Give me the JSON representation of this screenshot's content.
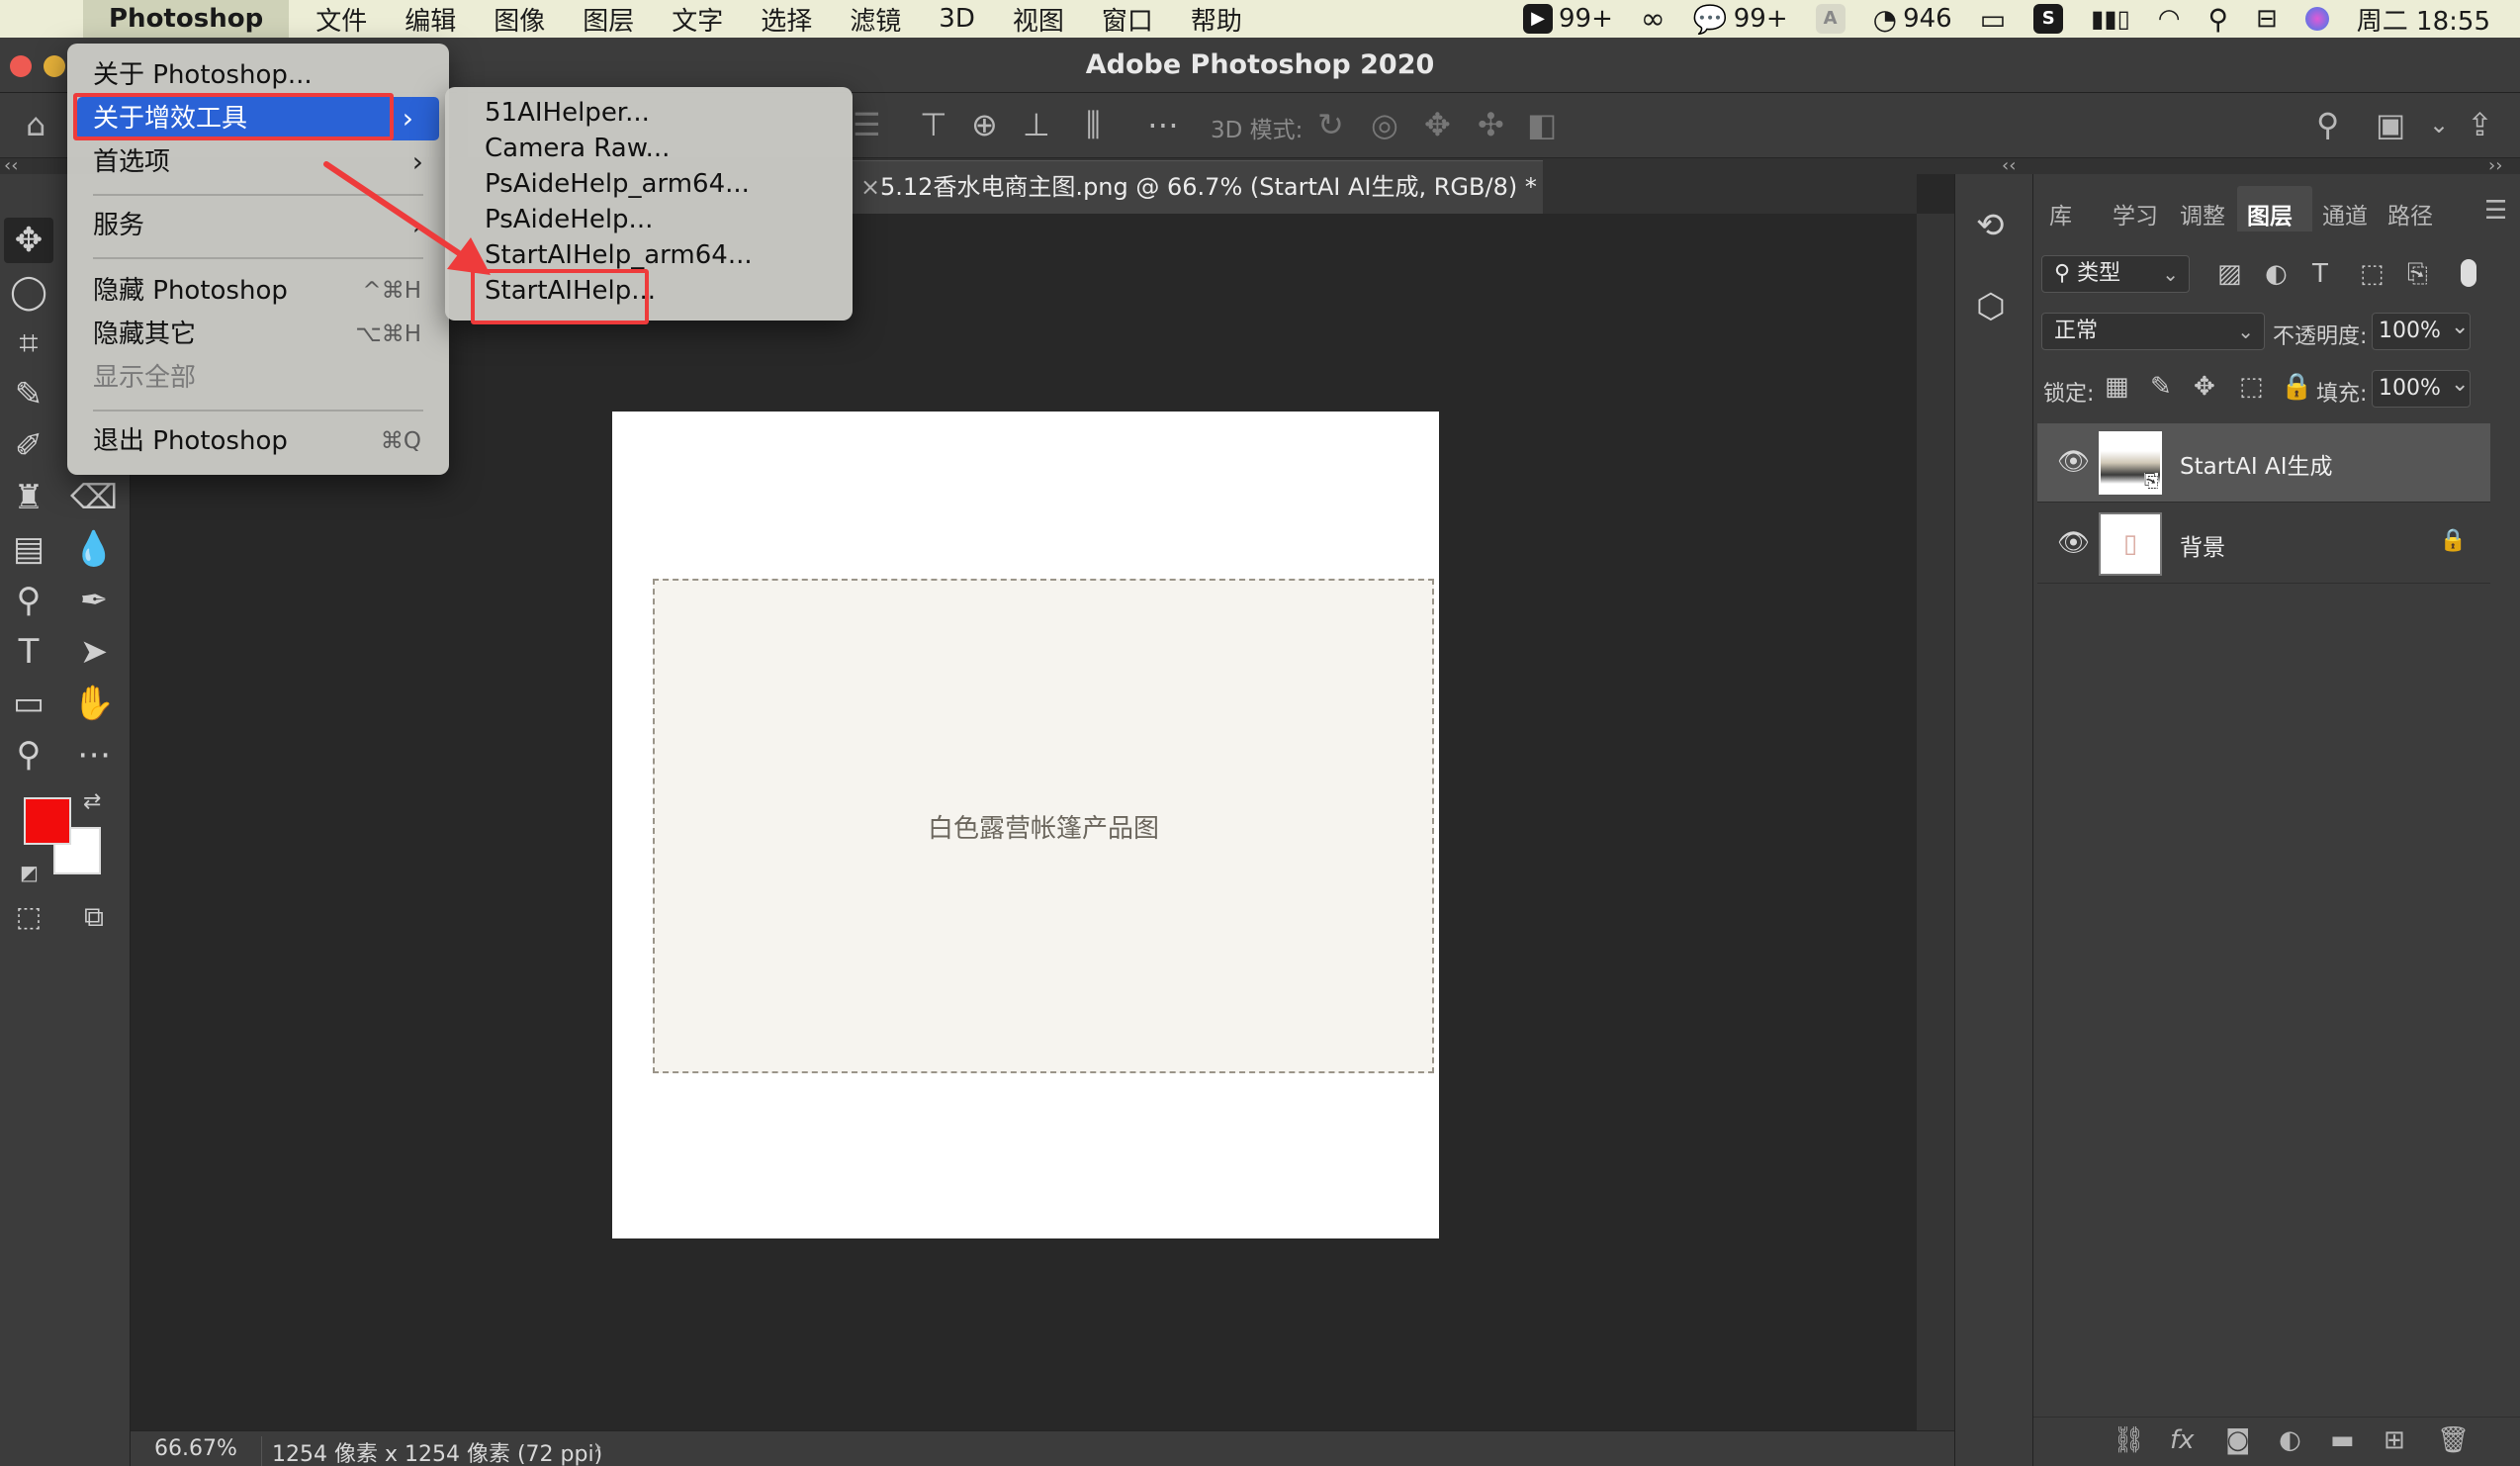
{
  "menubar": {
    "app_name": "Photoshop",
    "items": [
      "文件",
      "编辑",
      "图像",
      "图层",
      "文字",
      "选择",
      "滤镜",
      "3D",
      "视图",
      "窗口",
      "帮助"
    ],
    "status": {
      "feishu_count": "99+",
      "wechat_count": "99+",
      "qq_count": "946",
      "clock": "周二 18:55"
    }
  },
  "window": {
    "title": "Adobe Photoshop 2020"
  },
  "options_bar": {
    "mode_3d_label": "3D 模式:"
  },
  "document": {
    "tab_title": "5.12香水电商主图.png @ 66.7% (StartAI AI生成, RGB/8) *",
    "image_description": "白色露营帐篷产品图"
  },
  "status_bar": {
    "zoom": "66.67%",
    "doc_size": "1254 像素 x 1254 像素 (72 ppi)"
  },
  "app_menu": {
    "items": [
      {
        "label": "关于 Photoshop..."
      },
      {
        "label": "关于增效工具"
      },
      {
        "label": "首选项"
      },
      {
        "label": "服务"
      },
      {
        "label": "隐藏 Photoshop",
        "shortcut": "^⌘H"
      },
      {
        "label": "隐藏其它",
        "shortcut": "⌥⌘H"
      },
      {
        "label": "显示全部"
      },
      {
        "label": "退出 Photoshop",
        "shortcut": "⌘Q"
      }
    ]
  },
  "plugins_submenu": {
    "items": [
      "51AIHelper...",
      "Camera Raw...",
      "PsAideHelp_arm64...",
      "PsAideHelp...",
      "StartAIHelp_arm64...",
      "StartAIHelp..."
    ]
  },
  "layers_panel": {
    "tabs": [
      "库",
      "学习",
      "调整",
      "图层",
      "通道",
      "路径"
    ],
    "active_tab": "图层",
    "filter_kind": "类型",
    "blend_mode": "正常",
    "opacity_label": "不透明度:",
    "opacity_value": "100%",
    "lock_label": "锁定:",
    "fill_label": "填充:",
    "fill_value": "100%",
    "layers": [
      {
        "name": "StartAI AI生成",
        "selected": true
      },
      {
        "name": "背景",
        "locked": true
      }
    ]
  },
  "colors": {
    "foreground": "#f20c0c",
    "background": "#ffffff",
    "highlight": "#2a62d6",
    "annotation": "#ee3b3b"
  }
}
